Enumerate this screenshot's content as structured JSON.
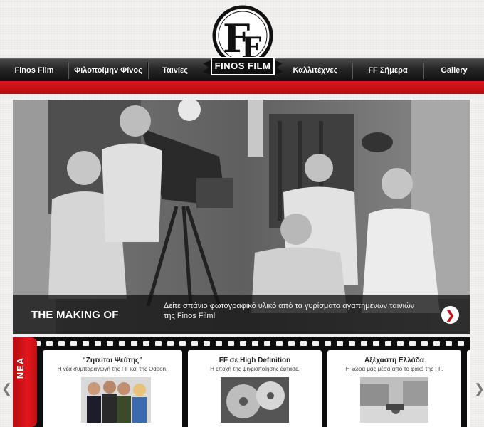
{
  "logo": {
    "text": "FINOS FILM",
    "monogram": "FF"
  },
  "nav": {
    "items": [
      {
        "label": "Finos Film"
      },
      {
        "label": "Φιλοποίμην Φίνος"
      },
      {
        "label": "Ταινίες"
      },
      {
        "label": "Καλλιτέχνες"
      },
      {
        "label": "FF Σήμερα"
      },
      {
        "label": "Gallery"
      }
    ]
  },
  "hero": {
    "title": "THE MAKING OF",
    "text": "Δείτε σπάνιο φωτογραφικό υλικό από τα γυρίσματα αγαπημένων ταινιών της Finos Film!",
    "next_icon": "chevron-right-icon"
  },
  "news": {
    "tab_label": "ΝΕΑ",
    "cards": [
      {
        "title": "“Ζητείται Ψεύτης”",
        "subtitle": "Η νέα συμπαραγωγή της FF και της Odeon.",
        "image": "cast-photo"
      },
      {
        "title": "FF σε High Definition",
        "subtitle": "Η εποχή της ψηφιοποίησης έφτασε.",
        "image": "film-reels-photo"
      },
      {
        "title": "Αξέχαστη Ελλάδα",
        "subtitle": "Η χώρα μας μέσα από το φακό της FF.",
        "image": "village-photo"
      }
    ],
    "prev_icon": "chevron-left-icon",
    "next_icon": "chevron-right-icon"
  },
  "colors": {
    "accent_red": "#d8121a",
    "nav_dark": "#1a1a1a"
  }
}
